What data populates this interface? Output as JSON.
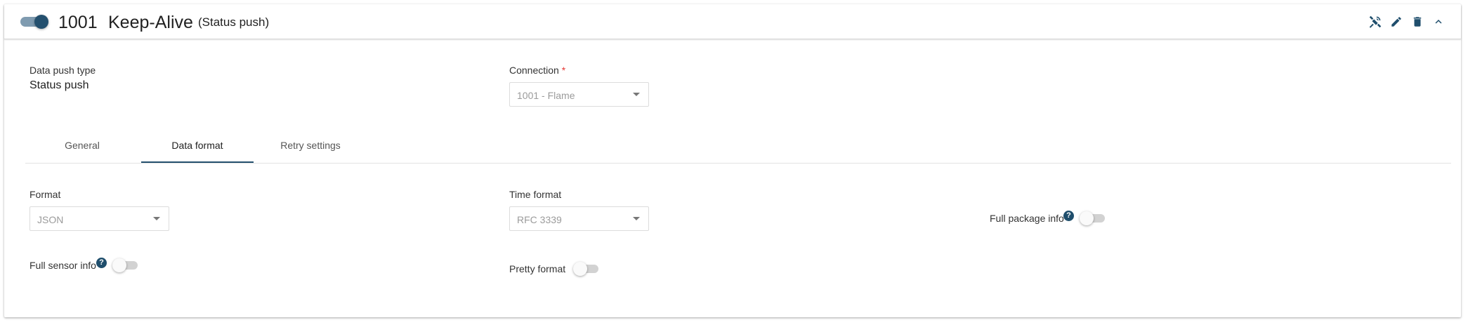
{
  "header": {
    "enabled": true,
    "id": "1001",
    "name": "Keep-Alive",
    "type_label": "(Status push)",
    "icons": [
      "satellite-icon",
      "pencil-icon",
      "trash-icon",
      "chevron-up-icon"
    ]
  },
  "summary": {
    "data_push_type_label": "Data push type",
    "data_push_type_value": "Status push",
    "connection_label": "Connection",
    "connection_required_mark": "*",
    "connection_value": "1001 - Flame"
  },
  "tabs": [
    {
      "label": "General",
      "active": false
    },
    {
      "label": "Data format",
      "active": true
    },
    {
      "label": "Retry settings",
      "active": false
    }
  ],
  "data_format": {
    "format_label": "Format",
    "format_value": "JSON",
    "time_format_label": "Time format",
    "time_format_value": "RFC 3339",
    "full_package_info_label": "Full package info",
    "full_package_info_enabled": false,
    "full_sensor_info_label": "Full sensor info",
    "full_sensor_info_enabled": false,
    "pretty_format_label": "Pretty format",
    "pretty_format_enabled": false,
    "help_glyph": "?"
  },
  "colors": {
    "accent": "#24506e",
    "required": "#e53935"
  }
}
